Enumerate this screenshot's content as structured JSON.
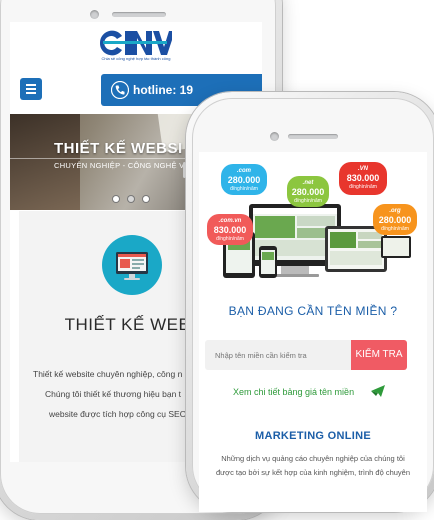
{
  "phone_left": {
    "logo_text": "CNV",
    "logo_tagline": "Chia sẻ công nghệ hợp tác thành công",
    "hotline_label": "hotline: 19",
    "banner_title": "THIẾT KẾ WEBSI",
    "banner_subtitle": "CHUYÊN NGHIỆP - CÔNG NGHỆ V",
    "slider_dots": [
      false,
      true,
      false
    ],
    "section_title": "THIẾT KẾ WEBSI",
    "section_lines": [
      "Thiết kế website chuyên nghiệp, công n",
      "Chúng tôi thiết kế thương hiệu bạn t",
      "website được tích hợp công cụ SEO"
    ],
    "icon": "monitor-website-icon"
  },
  "phone_right": {
    "domain_tags": [
      {
        "ext": ".com",
        "price": "280.000",
        "unit": "đ/nghìn/năm",
        "color": "#2fb4e9"
      },
      {
        "ext": ".net",
        "price": "280.000",
        "unit": "đ/nghìn/năm",
        "color": "#8cc63f"
      },
      {
        "ext": ".VN",
        "price": "830.000",
        "unit": "đ/nghìn/năm",
        "color": "#e8362d"
      },
      {
        "ext": ".com.vn",
        "price": "830.000",
        "unit": "đ/nghìn/năm",
        "color": "#f15a59"
      },
      {
        "ext": ".org",
        "price": "280.000",
        "unit": "đ/nghìn/năm",
        "color": "#f7941d"
      }
    ],
    "domain_heading": "BẠN ĐANG CẦN TÊN MIỀN ?",
    "search_placeholder": "Nhập tên miền cần kiểm tra",
    "check_button": "KIỂM TRA",
    "price_link": "Xem chi tiết bảng giá tên miền",
    "marketing_heading": "MARKETING ONLINE",
    "marketing_lines": [
      "Những dịch vụ quảng cáo chuyên nghiệp của chúng tôi",
      "được tạo bởi sự kết hợp của kinh nghiệm, trình độ chuyên"
    ]
  }
}
